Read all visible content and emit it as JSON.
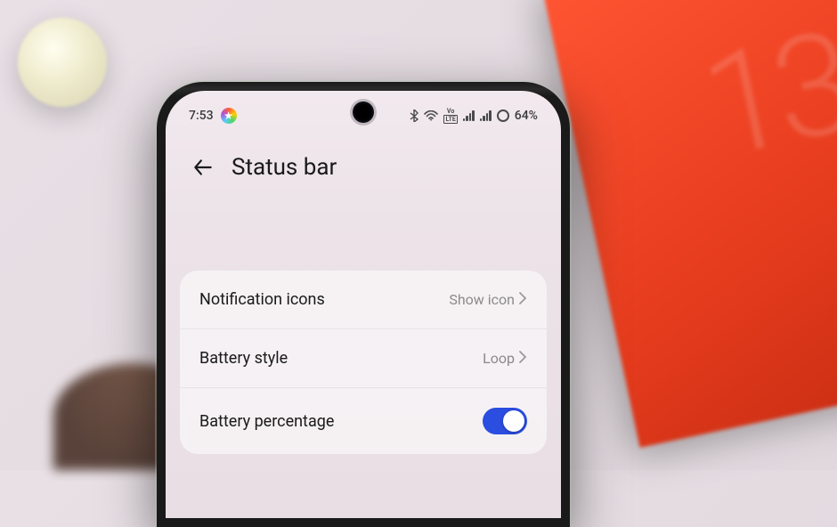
{
  "statusbar": {
    "time": "7:53",
    "volte": "VoLTE",
    "battery_pct": "64%"
  },
  "header": {
    "title": "Status bar"
  },
  "settings": {
    "notification_icons": {
      "label": "Notification icons",
      "value": "Show icon"
    },
    "battery_style": {
      "label": "Battery style",
      "value": "Loop"
    },
    "battery_percentage": {
      "label": "Battery percentage",
      "enabled": true
    }
  }
}
